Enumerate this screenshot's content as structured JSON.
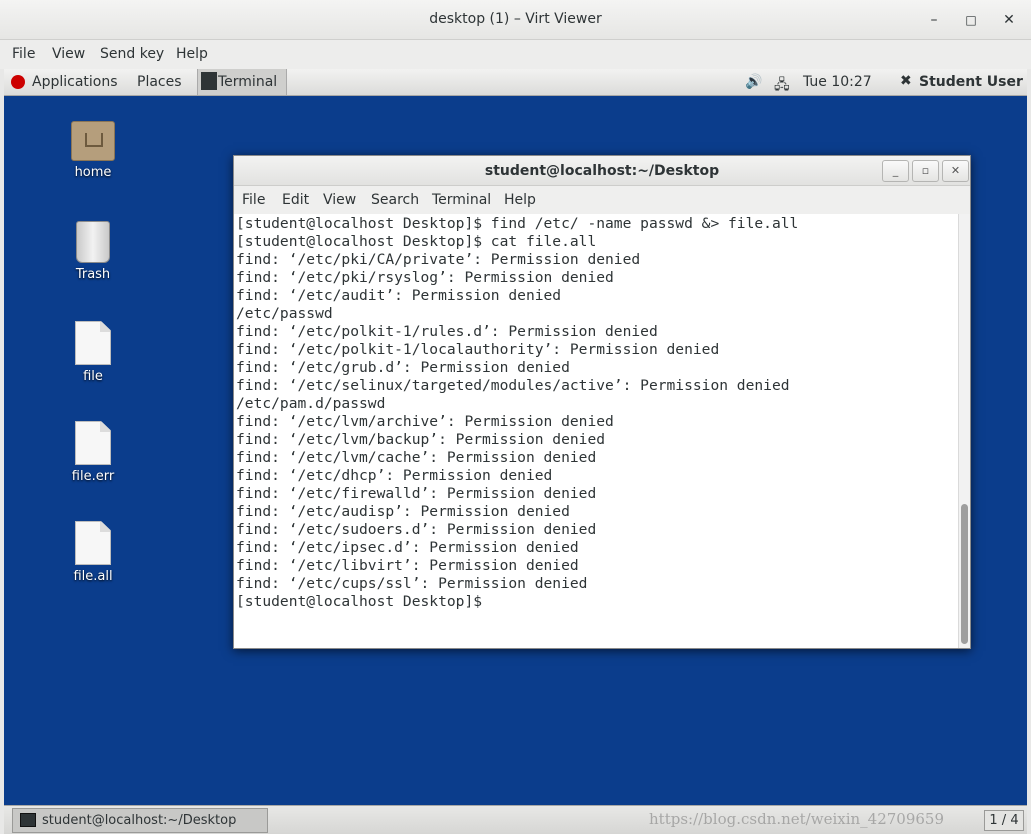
{
  "viewer": {
    "title": "desktop (1) – Virt Viewer",
    "menu": [
      "File",
      "View",
      "Send key",
      "Help"
    ],
    "minimize": "–",
    "maximize": "□",
    "close": "✕"
  },
  "panel": {
    "applications": "Applications",
    "places": "Places",
    "terminal_tab": "Terminal",
    "clock": "Tue 10:27",
    "user": "Student User"
  },
  "desktop_icons": [
    "home",
    "Trash",
    "file",
    "file.err",
    "file.all"
  ],
  "terminal": {
    "title": "student@localhost:~/Desktop",
    "menu": [
      "File",
      "Edit",
      "View",
      "Search",
      "Terminal",
      "Help"
    ],
    "lines": [
      "[student@localhost Desktop]$ find /etc/ -name passwd &> file.all",
      "[student@localhost Desktop]$ cat file.all",
      "find: ‘/etc/pki/CA/private’: Permission denied",
      "find: ‘/etc/pki/rsyslog’: Permission denied",
      "find: ‘/etc/audit’: Permission denied",
      "/etc/passwd",
      "find: ‘/etc/polkit-1/rules.d’: Permission denied",
      "find: ‘/etc/polkit-1/localauthority’: Permission denied",
      "find: ‘/etc/grub.d’: Permission denied",
      "find: ‘/etc/selinux/targeted/modules/active’: Permission denied",
      "/etc/pam.d/passwd",
      "find: ‘/etc/lvm/archive’: Permission denied",
      "find: ‘/etc/lvm/backup’: Permission denied",
      "find: ‘/etc/lvm/cache’: Permission denied",
      "find: ‘/etc/dhcp’: Permission denied",
      "find: ‘/etc/firewalld’: Permission denied",
      "find: ‘/etc/audisp’: Permission denied",
      "find: ‘/etc/sudoers.d’: Permission denied",
      "find: ‘/etc/ipsec.d’: Permission denied",
      "find: ‘/etc/libvirt’: Permission denied",
      "find: ‘/etc/cups/ssl’: Permission denied",
      "[student@localhost Desktop]$ "
    ]
  },
  "taskbar": {
    "window_title": "student@localhost:~/Desktop",
    "workspace": "1 / 4"
  },
  "watermark": "https://blog.csdn.net/weixin_42709659"
}
